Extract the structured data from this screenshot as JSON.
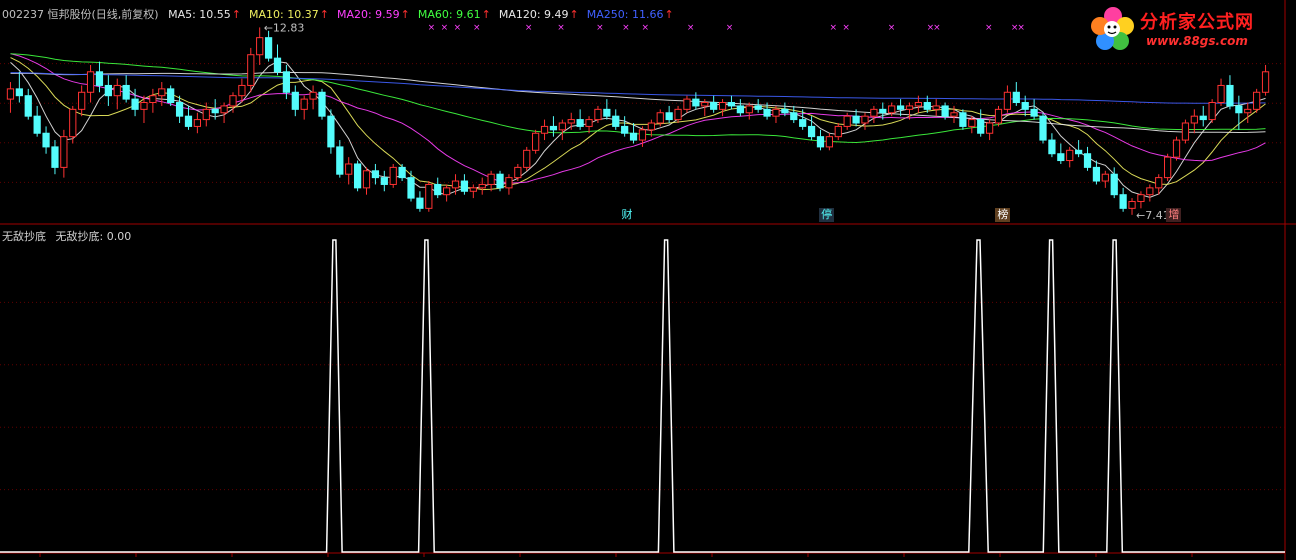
{
  "header": {
    "stock": "002237 恒邦股份(日线,前复权)",
    "ma": [
      {
        "label": "MA5: 10.55",
        "color": "#e8e8e8"
      },
      {
        "label": "MA10: 10.37",
        "color": "#f0f060"
      },
      {
        "label": "MA20: 9.59",
        "color": "#ff40ff"
      },
      {
        "label": "MA60: 9.61",
        "color": "#40ff40"
      },
      {
        "label": "MA120: 9.49",
        "color": "#e8e8e8"
      },
      {
        "label": "MA250: 11.66",
        "color": "#4060ff"
      }
    ],
    "up_arrow": "↑"
  },
  "indicator": {
    "name": "无敌抄底",
    "value_label": "无敌抄底: 0.00"
  },
  "logo": {
    "title": "分析家公式网",
    "url": "www.88gs.com"
  },
  "chart_data": [
    {
      "type": "candlestick",
      "title": "002237 恒邦股份(日线,前复权)",
      "price_annotations": [
        {
          "label": "12.83",
          "kind": "high"
        },
        {
          "label": "7.41",
          "kind": "low"
        }
      ],
      "event_tags": [
        "财",
        "停",
        "榜",
        "增"
      ],
      "candles_ohlc": [
        [
          10.8,
          11.3,
          10.4,
          11.1
        ],
        [
          11.1,
          11.6,
          10.7,
          10.9
        ],
        [
          10.9,
          11.1,
          10.2,
          10.3
        ],
        [
          10.3,
          10.6,
          9.7,
          9.8
        ],
        [
          9.8,
          10.0,
          9.2,
          9.4
        ],
        [
          9.4,
          9.6,
          8.6,
          8.8
        ],
        [
          8.8,
          9.9,
          8.5,
          9.7
        ],
        [
          9.7,
          10.6,
          9.5,
          10.5
        ],
        [
          10.5,
          11.2,
          10.3,
          11.0
        ],
        [
          11.0,
          11.8,
          10.7,
          11.6
        ],
        [
          11.6,
          11.9,
          11.0,
          11.2
        ],
        [
          11.2,
          11.5,
          10.6,
          10.9
        ],
        [
          10.9,
          11.4,
          10.5,
          11.2
        ],
        [
          11.2,
          11.5,
          10.7,
          10.8
        ],
        [
          10.8,
          11.1,
          10.3,
          10.5
        ],
        [
          10.5,
          10.9,
          10.1,
          10.7
        ],
        [
          10.7,
          11.1,
          10.4,
          10.9
        ],
        [
          10.9,
          11.3,
          10.6,
          11.1
        ],
        [
          11.1,
          11.2,
          10.6,
          10.7
        ],
        [
          10.7,
          10.9,
          10.1,
          10.3
        ],
        [
          10.3,
          10.6,
          9.9,
          10.0
        ],
        [
          10.0,
          10.4,
          9.8,
          10.2
        ],
        [
          10.2,
          10.7,
          10.0,
          10.5
        ],
        [
          10.5,
          10.8,
          10.2,
          10.4
        ],
        [
          10.4,
          10.7,
          10.1,
          10.6
        ],
        [
          10.6,
          11.0,
          10.4,
          10.9
        ],
        [
          10.9,
          11.4,
          10.7,
          11.2
        ],
        [
          11.2,
          12.3,
          11.0,
          12.1
        ],
        [
          12.1,
          12.9,
          11.8,
          12.6
        ],
        [
          12.6,
          12.8,
          11.9,
          12.0
        ],
        [
          12.0,
          12.4,
          11.5,
          11.6
        ],
        [
          11.6,
          11.8,
          10.8,
          11.0
        ],
        [
          11.0,
          11.2,
          10.3,
          10.5
        ],
        [
          10.5,
          10.9,
          10.2,
          10.8
        ],
        [
          10.8,
          11.2,
          10.5,
          11.0
        ],
        [
          11.0,
          11.1,
          10.2,
          10.3
        ],
        [
          10.3,
          10.5,
          9.2,
          9.4
        ],
        [
          9.4,
          9.6,
          8.5,
          8.6
        ],
        [
          8.6,
          9.1,
          8.3,
          8.9
        ],
        [
          8.9,
          9.0,
          8.1,
          8.2
        ],
        [
          8.2,
          8.8,
          8.0,
          8.7
        ],
        [
          8.7,
          8.9,
          8.3,
          8.5
        ],
        [
          8.5,
          8.7,
          8.1,
          8.3
        ],
        [
          8.3,
          8.9,
          8.2,
          8.8
        ],
        [
          8.8,
          8.9,
          8.4,
          8.5
        ],
        [
          8.5,
          8.7,
          7.8,
          7.9
        ],
        [
          7.9,
          8.1,
          7.5,
          7.6
        ],
        [
          7.6,
          8.4,
          7.5,
          8.3
        ],
        [
          8.3,
          8.5,
          7.9,
          8.0
        ],
        [
          8.0,
          8.3,
          7.8,
          8.2
        ],
        [
          8.2,
          8.6,
          8.0,
          8.4
        ],
        [
          8.4,
          8.6,
          8.0,
          8.1
        ],
        [
          8.1,
          8.3,
          7.9,
          8.2
        ],
        [
          8.2,
          8.5,
          8.0,
          8.3
        ],
        [
          8.3,
          8.7,
          8.1,
          8.6
        ],
        [
          8.6,
          8.7,
          8.1,
          8.2
        ],
        [
          8.2,
          8.6,
          8.0,
          8.5
        ],
        [
          8.5,
          8.9,
          8.4,
          8.8
        ],
        [
          8.8,
          9.4,
          8.7,
          9.3
        ],
        [
          9.3,
          9.9,
          9.2,
          9.8
        ],
        [
          9.8,
          10.2,
          9.6,
          10.0
        ],
        [
          10.0,
          10.3,
          9.7,
          9.9
        ],
        [
          9.9,
          10.2,
          9.6,
          10.1
        ],
        [
          10.1,
          10.4,
          9.9,
          10.2
        ],
        [
          10.2,
          10.5,
          9.9,
          10.0
        ],
        [
          10.0,
          10.3,
          9.8,
          10.2
        ],
        [
          10.2,
          10.6,
          10.1,
          10.5
        ],
        [
          10.5,
          10.8,
          10.2,
          10.3
        ],
        [
          10.3,
          10.5,
          9.9,
          10.0
        ],
        [
          10.0,
          10.3,
          9.7,
          9.8
        ],
        [
          9.8,
          10.1,
          9.5,
          9.6
        ],
        [
          9.6,
          10.0,
          9.4,
          9.9
        ],
        [
          9.9,
          10.2,
          9.7,
          10.1
        ],
        [
          10.1,
          10.5,
          10.0,
          10.4
        ],
        [
          10.4,
          10.6,
          10.1,
          10.2
        ],
        [
          10.2,
          10.6,
          10.1,
          10.5
        ],
        [
          10.5,
          10.9,
          10.4,
          10.8
        ],
        [
          10.8,
          11.0,
          10.5,
          10.6
        ],
        [
          10.6,
          10.8,
          10.3,
          10.7
        ],
        [
          10.7,
          10.9,
          10.4,
          10.5
        ],
        [
          10.5,
          10.8,
          10.3,
          10.7
        ],
        [
          10.7,
          10.9,
          10.5,
          10.6
        ],
        [
          10.6,
          10.8,
          10.3,
          10.4
        ],
        [
          10.4,
          10.7,
          10.2,
          10.6
        ],
        [
          10.6,
          10.8,
          10.4,
          10.5
        ],
        [
          10.5,
          10.7,
          10.2,
          10.3
        ],
        [
          10.3,
          10.6,
          10.1,
          10.5
        ],
        [
          10.5,
          10.7,
          10.3,
          10.4
        ],
        [
          10.4,
          10.6,
          10.1,
          10.2
        ],
        [
          10.2,
          10.5,
          9.9,
          10.0
        ],
        [
          10.0,
          10.3,
          9.6,
          9.7
        ],
        [
          9.7,
          9.9,
          9.3,
          9.4
        ],
        [
          9.4,
          9.8,
          9.3,
          9.7
        ],
        [
          9.7,
          10.1,
          9.6,
          10.0
        ],
        [
          10.0,
          10.4,
          9.9,
          10.3
        ],
        [
          10.3,
          10.5,
          10.0,
          10.1
        ],
        [
          10.1,
          10.4,
          9.9,
          10.3
        ],
        [
          10.3,
          10.6,
          10.1,
          10.5
        ],
        [
          10.5,
          10.7,
          10.2,
          10.4
        ],
        [
          10.4,
          10.7,
          10.3,
          10.6
        ],
        [
          10.6,
          10.8,
          10.3,
          10.5
        ],
        [
          10.5,
          10.7,
          10.2,
          10.6
        ],
        [
          10.6,
          10.9,
          10.4,
          10.7
        ],
        [
          10.7,
          10.9,
          10.4,
          10.5
        ],
        [
          10.5,
          10.8,
          10.3,
          10.6
        ],
        [
          10.6,
          10.7,
          10.2,
          10.3
        ],
        [
          10.3,
          10.6,
          10.1,
          10.4
        ],
        [
          10.4,
          10.5,
          9.9,
          10.0
        ],
        [
          10.0,
          10.3,
          9.8,
          10.2
        ],
        [
          10.2,
          10.5,
          9.7,
          9.8
        ],
        [
          9.8,
          10.2,
          9.6,
          10.1
        ],
        [
          10.1,
          10.6,
          10.0,
          10.5
        ],
        [
          10.5,
          11.2,
          10.4,
          11.0
        ],
        [
          11.0,
          11.3,
          10.6,
          10.7
        ],
        [
          10.7,
          10.9,
          10.3,
          10.5
        ],
        [
          10.5,
          10.8,
          10.2,
          10.3
        ],
        [
          10.3,
          10.4,
          9.5,
          9.6
        ],
        [
          9.6,
          9.8,
          9.1,
          9.2
        ],
        [
          9.2,
          9.5,
          8.9,
          9.0
        ],
        [
          9.0,
          9.4,
          8.8,
          9.3
        ],
        [
          9.3,
          9.6,
          9.1,
          9.2
        ],
        [
          9.2,
          9.4,
          8.7,
          8.8
        ],
        [
          8.8,
          9.0,
          8.3,
          8.4
        ],
        [
          8.4,
          8.7,
          8.2,
          8.6
        ],
        [
          8.6,
          8.8,
          7.9,
          8.0
        ],
        [
          8.0,
          8.2,
          7.5,
          7.6
        ],
        [
          7.6,
          7.9,
          7.41,
          7.8
        ],
        [
          7.8,
          8.1,
          7.6,
          8.0
        ],
        [
          8.0,
          8.3,
          7.8,
          8.2
        ],
        [
          8.2,
          8.6,
          8.0,
          8.5
        ],
        [
          8.5,
          9.2,
          8.4,
          9.1
        ],
        [
          9.1,
          9.7,
          9.0,
          9.6
        ],
        [
          9.6,
          10.2,
          9.5,
          10.1
        ],
        [
          10.1,
          10.5,
          9.8,
          10.3
        ],
        [
          10.3,
          10.6,
          10.0,
          10.2
        ],
        [
          10.2,
          10.8,
          10.1,
          10.7
        ],
        [
          10.7,
          11.4,
          10.6,
          11.2
        ],
        [
          11.2,
          11.5,
          10.5,
          10.6
        ],
        [
          10.6,
          10.9,
          9.9,
          10.4
        ],
        [
          10.4,
          10.7,
          10.1,
          10.5
        ],
        [
          10.5,
          11.1,
          10.4,
          11.0
        ],
        [
          11.0,
          11.8,
          10.9,
          11.6
        ]
      ],
      "ma_series": [
        {
          "name": "MA5",
          "period": 5,
          "color": "#e8e8e8"
        },
        {
          "name": "MA10",
          "period": 10,
          "color": "#f0f060"
        },
        {
          "name": "MA20",
          "period": 20,
          "color": "#ff40ff"
        },
        {
          "name": "MA60",
          "period": 60,
          "color": "#40ff40"
        },
        {
          "name": "MA120",
          "period": 120,
          "color": "#e8e8e8"
        },
        {
          "name": "MA250",
          "period": 250,
          "color": "#4060ff"
        }
      ],
      "ylim": [
        7.2,
        13.0
      ]
    },
    {
      "type": "line",
      "title": "无敌抄底",
      "series": [
        {
          "name": "无敌抄底",
          "color": "#ffffff",
          "spikes": [
            {
              "x": 0.258,
              "w": 0.012
            },
            {
              "x": 0.329,
              "w": 0.012
            },
            {
              "x": 0.514,
              "w": 0.012
            },
            {
              "x": 0.755,
              "w": 0.015
            },
            {
              "x": 0.811,
              "w": 0.012
            },
            {
              "x": 0.86,
              "w": 0.012
            }
          ]
        }
      ],
      "ylim": [
        0,
        1
      ]
    }
  ]
}
